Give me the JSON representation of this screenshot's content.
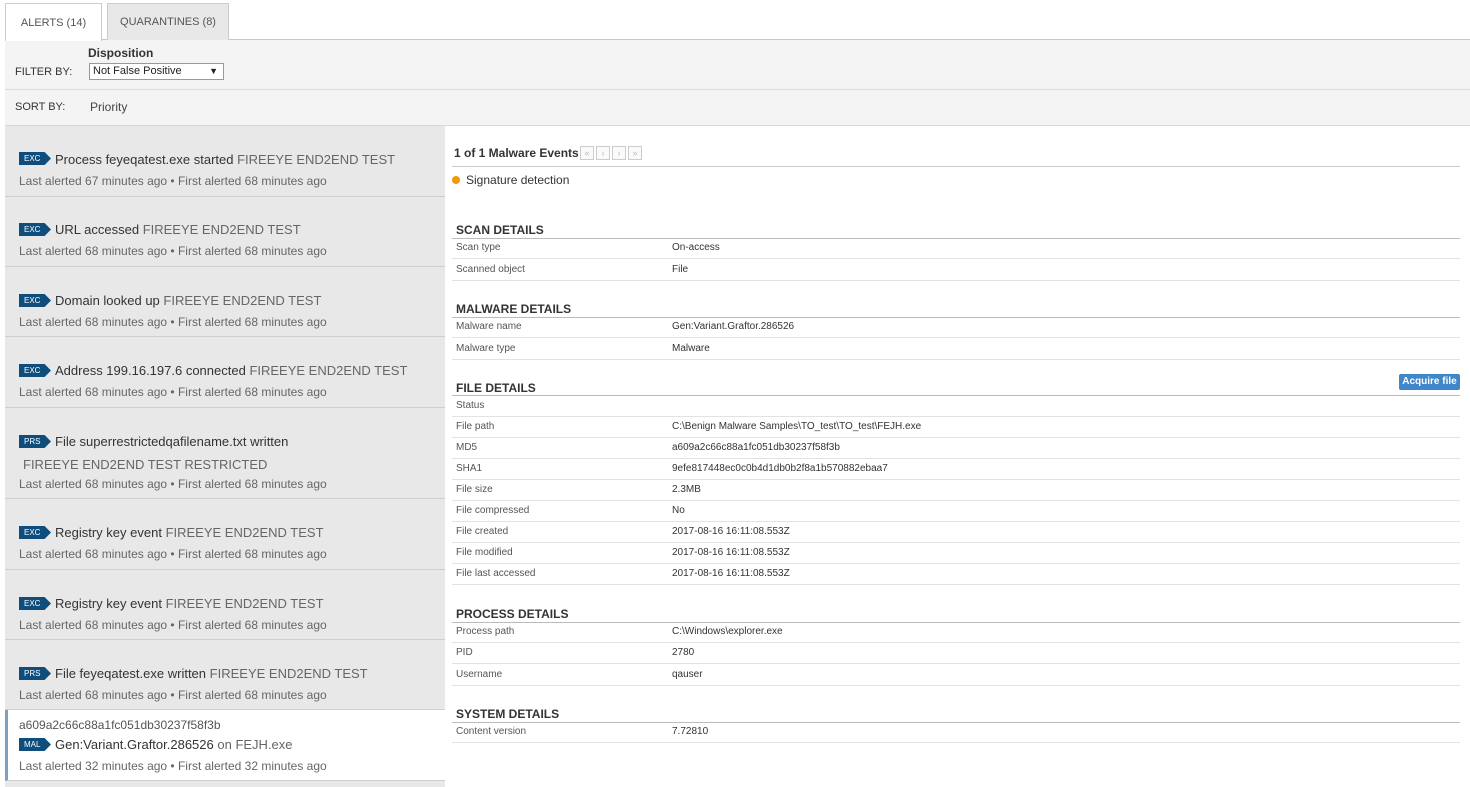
{
  "tabs": {
    "alerts": "ALERTS (14)",
    "quarantines": "QUARANTINES (8)"
  },
  "filter": {
    "title": "Disposition",
    "label": "FILTER BY:",
    "selected": "Not False Positive"
  },
  "sort": {
    "label": "SORT BY:",
    "value": "Priority"
  },
  "alerts": [
    {
      "badge": "EXC",
      "title": "Process feyeqatest.exe started",
      "host": "FIREEYE END2END TEST",
      "meta": "Last alerted 67 minutes ago • First alerted 68 minutes ago"
    },
    {
      "badge": "EXC",
      "title": "URL accessed",
      "host": "FIREEYE END2END TEST",
      "meta": "Last alerted 68 minutes ago • First alerted 68 minutes ago"
    },
    {
      "badge": "EXC",
      "title": "Domain looked up",
      "host": "FIREEYE END2END TEST",
      "meta": "Last alerted 68 minutes ago • First alerted 68 minutes ago"
    },
    {
      "badge": "EXC",
      "title": "Address 199.16.197.6 connected",
      "host": "FIREEYE END2END TEST",
      "meta": "Last alerted 68 minutes ago • First alerted 68 minutes ago"
    },
    {
      "badge": "PRS",
      "title": "File superrestrictedqafilename.txt written",
      "host": "FIREEYE END2END TEST RESTRICTED",
      "meta": "Last alerted 68 minutes ago • First alerted 68 minutes ago"
    },
    {
      "badge": "EXC",
      "title": "Registry key event",
      "host": "FIREEYE END2END TEST",
      "meta": "Last alerted 68 minutes ago • First alerted 68 minutes ago"
    },
    {
      "badge": "EXC",
      "title": "Registry key event",
      "host": "FIREEYE END2END TEST",
      "meta": "Last alerted 68 minutes ago • First alerted 68 minutes ago"
    },
    {
      "badge": "PRS",
      "title": "File feyeqatest.exe written",
      "host": "FIREEYE END2END TEST",
      "meta": "Last alerted 68 minutes ago • First alerted 68 minutes ago"
    },
    {
      "hash": "a609a2c66c88a1fc051db30237f58f3b",
      "badge": "MAL",
      "title": "Gen:Variant.Graftor.286526",
      "host": "on FEJH.exe",
      "meta": "Last alerted 32 minutes ago • First alerted 32 minutes ago"
    }
  ],
  "detail": {
    "events_header": "1 of 1 Malware Events",
    "nav": [
      "«",
      "‹",
      "›",
      "»"
    ],
    "detection": "Signature detection",
    "detection_color": "#f19b00",
    "acquire_label": "Acquire file",
    "sections": {
      "scan": {
        "title": "SCAN DETAILS",
        "rows": [
          {
            "k": "Scan type",
            "v": "On-access"
          },
          {
            "k": "Scanned object",
            "v": "File"
          }
        ]
      },
      "malware": {
        "title": "MALWARE DETAILS",
        "rows": [
          {
            "k": "Malware name",
            "v": "Gen:Variant.Graftor.286526"
          },
          {
            "k": "Malware type",
            "v": "Malware"
          }
        ]
      },
      "file": {
        "title": "FILE DETAILS",
        "rows": [
          {
            "k": "Status",
            "v": ""
          },
          {
            "k": "File path",
            "v": "C:\\Benign Malware Samples\\TO_test\\TO_test\\FEJH.exe"
          },
          {
            "k": "MD5",
            "v": "a609a2c66c88a1fc051db30237f58f3b"
          },
          {
            "k": "SHA1",
            "v": "9efe817448ec0c0b4d1db0b2f8a1b570882ebaa7"
          },
          {
            "k": "File size",
            "v": "2.3MB"
          },
          {
            "k": "File compressed",
            "v": "No"
          },
          {
            "k": "File created",
            "v": "2017-08-16 16:11:08.553Z"
          },
          {
            "k": "File modified",
            "v": "2017-08-16 16:11:08.553Z"
          },
          {
            "k": "File last accessed",
            "v": "2017-08-16 16:11:08.553Z"
          }
        ]
      },
      "process": {
        "title": "PROCESS DETAILS",
        "rows": [
          {
            "k": "Process path",
            "v": "C:\\Windows\\explorer.exe"
          },
          {
            "k": "PID",
            "v": "2780"
          },
          {
            "k": "Username",
            "v": "qauser"
          }
        ]
      },
      "system": {
        "title": "SYSTEM DETAILS",
        "rows": [
          {
            "k": "Content version",
            "v": "7.72810"
          }
        ]
      }
    }
  }
}
